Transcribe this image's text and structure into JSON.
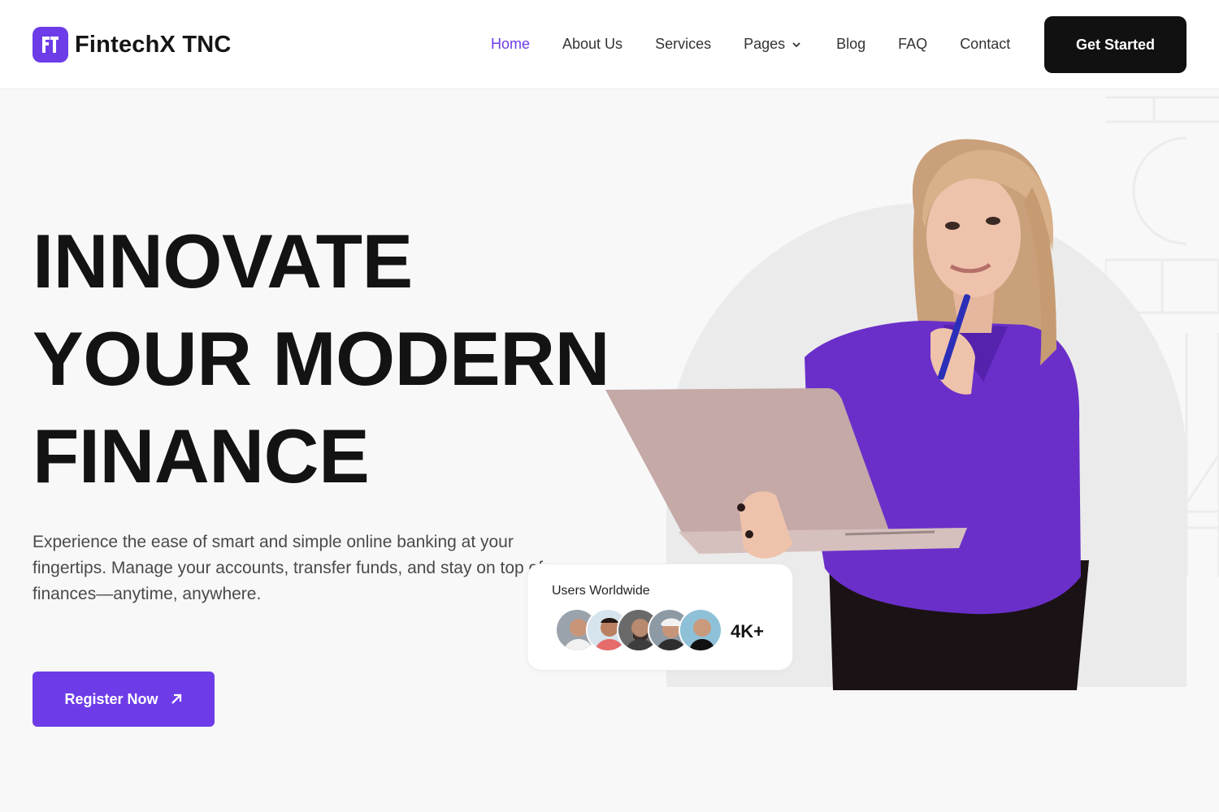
{
  "brand": {
    "name": "FintechX TNC",
    "logo_icon": "ft-monogram-icon",
    "accent": "#6d3ce8"
  },
  "nav": {
    "items": [
      {
        "label": "Home",
        "active": true
      },
      {
        "label": "About Us"
      },
      {
        "label": "Services"
      },
      {
        "label": "Pages",
        "has_dropdown": true
      },
      {
        "label": "Blog"
      },
      {
        "label": "FAQ"
      },
      {
        "label": "Contact"
      }
    ],
    "cta_label": "Get Started"
  },
  "hero": {
    "heading_lines": [
      "INNOVATE",
      "YOUR MODERN",
      "FINANCE"
    ],
    "subtitle": "Experience the ease of smart and simple online banking at your fingertips. Manage your accounts, transfer funds, and stay on top of finances—anytime, anywhere.",
    "register_label": "Register Now",
    "register_icon": "arrow-up-right-icon"
  },
  "users_card": {
    "title": "Users Worldwide",
    "count": "4K+",
    "avatars": [
      "avatar-1",
      "avatar-2",
      "avatar-3",
      "avatar-4",
      "avatar-5"
    ]
  },
  "colors": {
    "dark": "#111111",
    "background": "#f8f8f8",
    "arch": "#ebebeb",
    "shirt": "#6a2fc9"
  }
}
